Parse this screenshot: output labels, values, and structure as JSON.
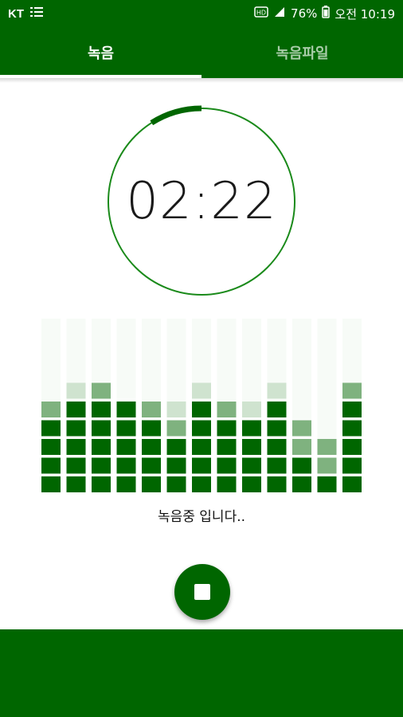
{
  "status_bar": {
    "carrier": "KT",
    "notification_icon": "list-icon",
    "battery_percent": "76%",
    "time": "오전 10:19",
    "colors": {
      "background": "#006600",
      "text": "#ffffff"
    }
  },
  "tabs": [
    {
      "label": "녹음",
      "active": true
    },
    {
      "label": "녹음파일",
      "active": false
    }
  ],
  "timer": {
    "display": "02:22",
    "progress_fraction": 0.09
  },
  "visualizer": {
    "bar_count": 13,
    "segments_per_bar": 5,
    "levels": [
      4.8,
      5.1,
      5.9,
      5.0,
      4.7,
      4.3,
      5.2,
      4.9,
      4.6,
      5.6,
      3.9,
      2.6,
      5.7
    ],
    "colors": {
      "strong": "#006600",
      "mid": "#7fb27f",
      "light": "#cfe3cf",
      "faint": "#eef5ee"
    }
  },
  "status_message": "녹음중 입니다..",
  "stop_button_icon": "stop-icon",
  "theme": {
    "primary": "#006600",
    "background": "#ffffff"
  }
}
